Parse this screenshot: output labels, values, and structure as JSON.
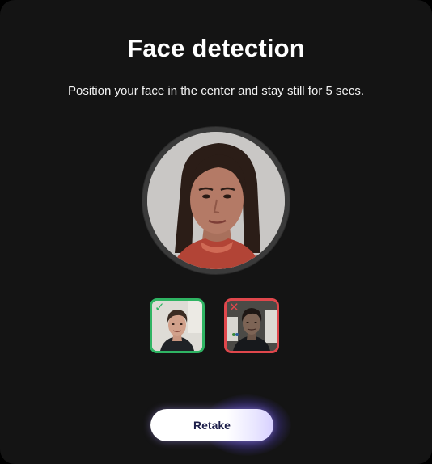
{
  "dialog": {
    "title": "Face detection",
    "instruction": "Position your face in the center and stay still for 5 secs."
  },
  "examples": {
    "good_marker": "✓",
    "bad_marker": "✕"
  },
  "actions": {
    "retake_label": "Retake"
  },
  "colors": {
    "background": "#141414",
    "good": "#2fb463",
    "bad": "#e0474c",
    "button_text": "#1d1f4a",
    "glow": "#8c78ff"
  }
}
